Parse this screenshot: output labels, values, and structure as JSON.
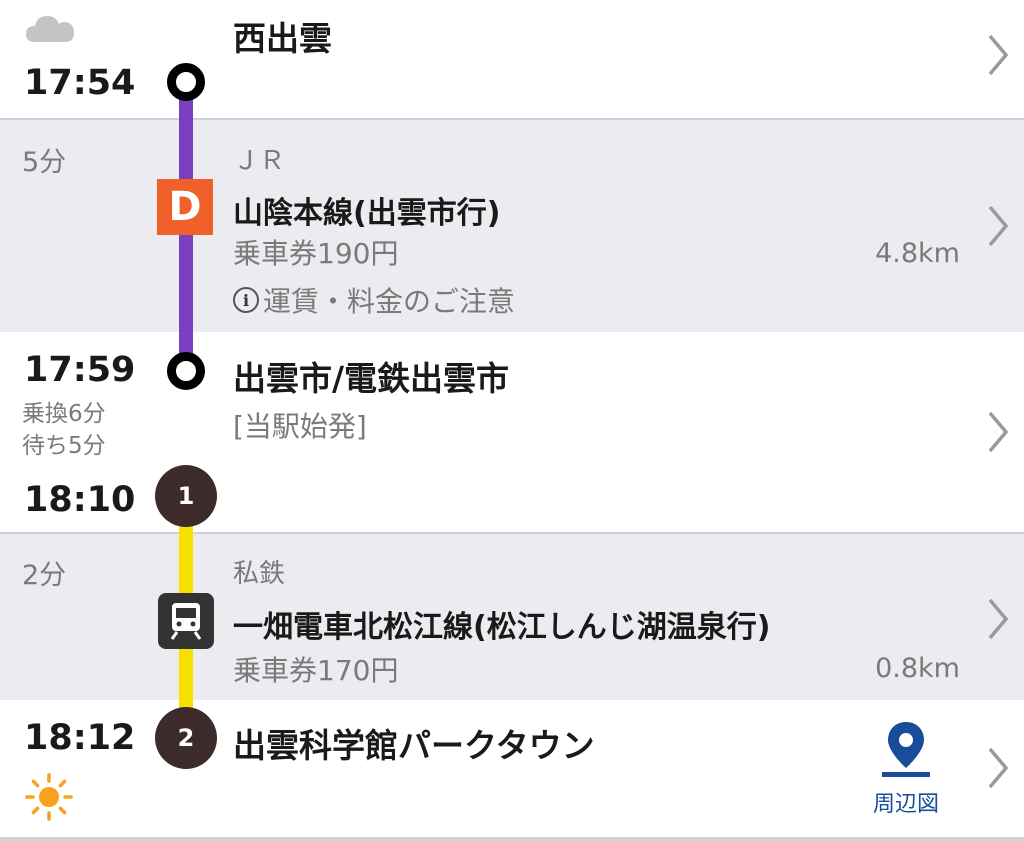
{
  "origin": {
    "time": "17:54",
    "station": "西出雲",
    "weather_icon": "cloud-icon"
  },
  "leg1": {
    "duration": "5分",
    "company": "ＪＲ",
    "line_badge": "D",
    "line_name": "山陰本線(出雲市行)",
    "fare": "乗車券190円",
    "distance": "4.8km",
    "note": "運賃・料金のご注意",
    "line_color": "#7b3fbf"
  },
  "transfer": {
    "arrive_time": "17:59",
    "station": "出雲市/電鉄出雲市",
    "note": "[当駅始発]",
    "transfer_walk": "乗換6分",
    "transfer_wait": "待ち5分",
    "depart_time": "18:10",
    "node_number": "1"
  },
  "leg2": {
    "duration": "2分",
    "company": "私鉄",
    "line_name": "一畑電車北松江線(松江しんじ湖温泉行)",
    "fare": "乗車券170円",
    "distance": "0.8km",
    "line_color": "#f5e000",
    "line_icon": "train-icon"
  },
  "destination": {
    "time": "18:12",
    "station": "出雲科学館パークタウン",
    "node_number": "2",
    "weather_icon": "sun-icon",
    "map_label": "周辺図"
  },
  "colors": {
    "accent_blue": "#1a4d99",
    "badge_orange": "#f0602a",
    "node_dark": "#3d2b2b"
  }
}
